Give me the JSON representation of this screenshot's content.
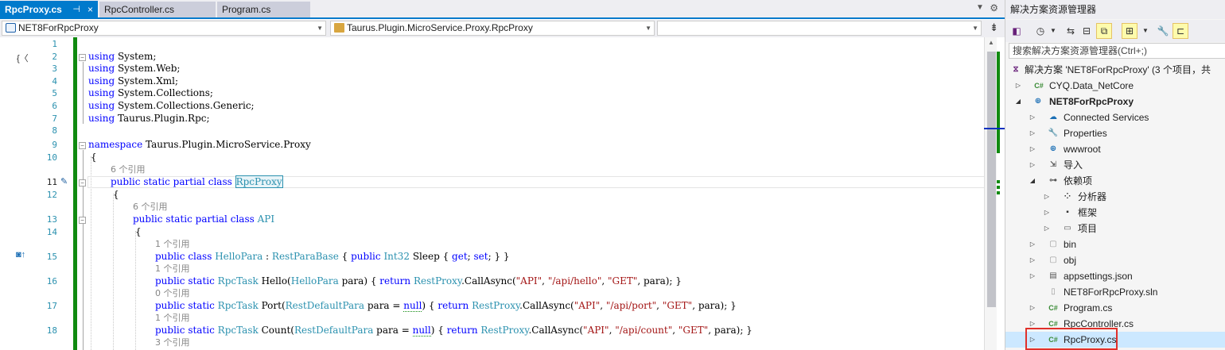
{
  "tabs": [
    {
      "label": "RpcProxy.cs",
      "active": true,
      "pin": "⊣",
      "close": "×"
    },
    {
      "label": "RpcController.cs",
      "active": false
    },
    {
      "label": "Program.cs",
      "active": false
    }
  ],
  "nav": {
    "project": "NET8ForRpcProxy",
    "type": "Taurus.Plugin.MicroService.Proxy.RpcProxy",
    "member": ""
  },
  "lines": [
    {
      "n": "1"
    },
    {
      "n": "2"
    },
    {
      "n": "3"
    },
    {
      "n": "4"
    },
    {
      "n": "5"
    },
    {
      "n": "6"
    },
    {
      "n": "7"
    },
    {
      "n": "8"
    },
    {
      "n": "9"
    },
    {
      "n": "10"
    },
    {
      "n": "11"
    },
    {
      "n": "12"
    },
    {
      "n": "13"
    },
    {
      "n": "14"
    },
    {
      "n": "15"
    },
    {
      "n": "16"
    },
    {
      "n": "17"
    },
    {
      "n": "18"
    }
  ],
  "code": {
    "kw_using": "using",
    "u1": " System;",
    "u2": " System.Web;",
    "u3": " System.Xml;",
    "u4": " System.Collections;",
    "u5": " System.Collections.Generic;",
    "u6": " Taurus.Plugin.Rpc;",
    "kw_namespace": "namespace",
    "ns_name": " Taurus.Plugin.MicroService.Proxy",
    "brace_open": "{",
    "ref6a": "6 个引用",
    "ref6b": "6 个引用",
    "ref1a": "1 个引用",
    "ref1b": "1 个引用",
    "ref0": "0 个引用",
    "ref1c": "1 个引用",
    "ref3": "3 个引用",
    "kw_public": "public",
    "kw_static": "static",
    "kw_partial": "partial",
    "kw_class": "class",
    "cls_rpcproxy": "RpcProxy",
    "cls_api": "API",
    "l15_cls": "HelloPara",
    "l15_colon": " : ",
    "l15_base": "RestParaBase",
    "l15_open": " { ",
    "kw_int32": "Int32",
    "l15_sleep": " Sleep { ",
    "kw_get": "get",
    "l15_semi": "; ",
    "kw_set": "set",
    "l15_close": "; } }",
    "ty_rpctask": "RpcTask",
    "l16_sig": " Hello(",
    "ty_hellopara": "HelloPara",
    "l16_para": " para) { ",
    "kw_return": "return",
    "ty_restproxy": "RestProxy",
    "call": ".CallAsync(",
    "s_api": "\"API\"",
    "comma": ", ",
    "s_hello": "\"/api/hello\"",
    "s_get": "\"GET\"",
    "l16_end": ", para); }",
    "l17_sig": " Port(",
    "ty_restdefault": "RestDefaultPara",
    "l17_para": " para = ",
    "kw_null": "null",
    "l17_mid": ") { ",
    "s_port": "\"/api/port\"",
    "l18_sig": " Count(",
    "s_count": "\"/api/count\""
  },
  "solution": {
    "title": "解决方案资源管理器",
    "search_placeholder": "搜索解决方案资源管理器(Ctrl+;)",
    "items": [
      {
        "label": "解决方案 'NET8ForRpcProxy' (3 个项目，共",
        "icon": "solution-icon"
      },
      {
        "label": "CYQ.Data_NetCore",
        "icon": "csharp-project-icon"
      },
      {
        "label": "NET8ForRpcProxy",
        "icon": "web-project-icon"
      },
      {
        "label": "Connected Services",
        "icon": "connected-services-icon"
      },
      {
        "label": "Properties",
        "icon": "wrench-icon"
      },
      {
        "label": "wwwroot",
        "icon": "globe-icon"
      },
      {
        "label": "导入",
        "icon": "import-icon"
      },
      {
        "label": "依赖项",
        "icon": "dependencies-icon"
      },
      {
        "label": "分析器",
        "icon": "analyzer-icon"
      },
      {
        "label": "框架",
        "icon": "framework-icon"
      },
      {
        "label": "项目",
        "icon": "project-ref-icon"
      },
      {
        "label": "bin",
        "icon": "folder-icon"
      },
      {
        "label": "obj",
        "icon": "folder-icon"
      },
      {
        "label": "appsettings.json",
        "icon": "json-file-icon"
      },
      {
        "label": "NET8ForRpcProxy.sln",
        "icon": "sln-file-icon"
      },
      {
        "label": "Program.cs",
        "icon": "cs-file-icon"
      },
      {
        "label": "RpcController.cs",
        "icon": "cs-file-icon"
      },
      {
        "label": "RpcProxy.cs",
        "icon": "cs-file-icon"
      }
    ],
    "cs_glyph": "C#"
  }
}
